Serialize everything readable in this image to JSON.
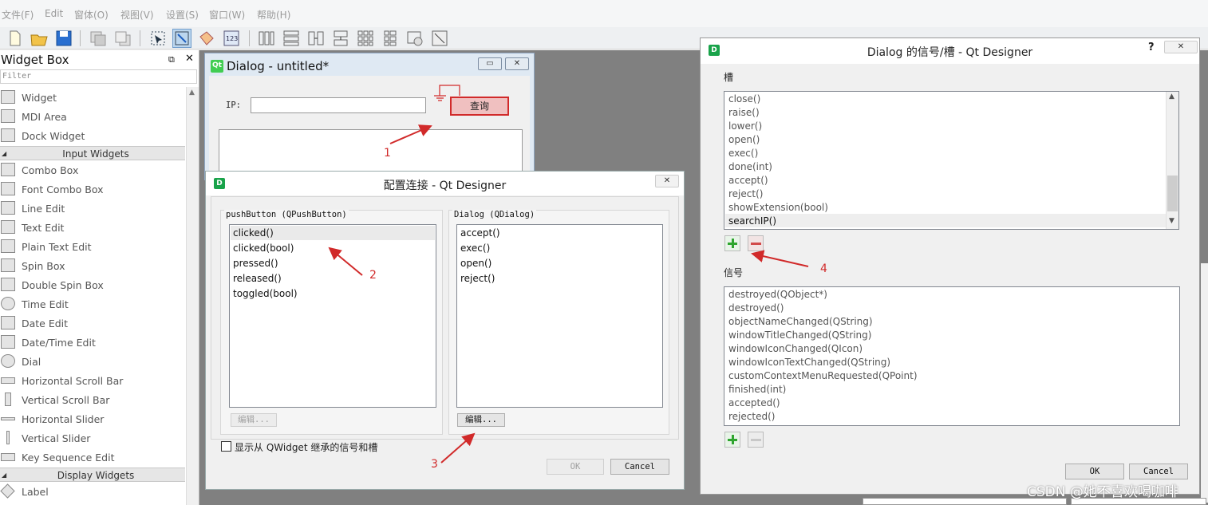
{
  "menubar": {
    "items": [
      "文件(F)",
      "Edit",
      "窗体(O)",
      "视图(V)",
      "设置(S)",
      "窗口(W)",
      "帮助(H)"
    ]
  },
  "widget_box": {
    "title": "Widget Box",
    "filter_placeholder": "Filter",
    "items": [
      "Widget",
      "MDI Area",
      "Dock Widget"
    ],
    "category_input": "Input Widgets",
    "input_items": [
      "Combo Box",
      "Font Combo Box",
      "Line Edit",
      "Text Edit",
      "Plain Text Edit",
      "Spin Box",
      "Double Spin Box",
      "Time Edit",
      "Date Edit",
      "Date/Time Edit",
      "Dial",
      "Horizontal Scroll Bar",
      "Vertical Scroll Bar",
      "Horizontal Slider",
      "Vertical Slider",
      "Key Sequence Edit"
    ],
    "category_display": "Display Widgets",
    "display_items": [
      "Label"
    ]
  },
  "form_dialog": {
    "title": "Dialog - untitled*",
    "ip_label": "IP:",
    "query_button": "查询"
  },
  "config_dialog": {
    "title": "配置连接 - Qt Designer",
    "left_group": "pushButton (QPushButton)",
    "left_items": [
      "clicked()",
      "clicked(bool)",
      "pressed()",
      "released()",
      "toggled(bool)"
    ],
    "left_edit": "编辑...",
    "right_group": "Dialog (QDialog)",
    "right_items": [
      "accept()",
      "exec()",
      "open()",
      "reject()"
    ],
    "right_edit": "编辑...",
    "checkbox_label": "显示从 QWidget 继承的信号和槽",
    "ok": "OK",
    "cancel": "Cancel"
  },
  "signal_slot_dialog": {
    "title": "Dialog 的信号/槽 - Qt Designer",
    "help": "?",
    "slots_label": "槽",
    "slots": [
      "close()",
      "raise()",
      "lower()",
      "open()",
      "exec()",
      "done(int)",
      "accept()",
      "reject()",
      "showExtension(bool)",
      "searchIP()"
    ],
    "signals_label": "信号",
    "signals": [
      "destroyed(QObject*)",
      "destroyed()",
      "objectNameChanged(QString)",
      "windowTitleChanged(QString)",
      "windowIconChanged(QIcon)",
      "windowIconTextChanged(QString)",
      "customContextMenuRequested(QPoint)",
      "finished(int)",
      "accepted()",
      "rejected()"
    ],
    "ok": "OK",
    "cancel": "Cancel"
  },
  "annotations": [
    "1",
    "2",
    "3",
    "4"
  ],
  "watermark": "CSDN @她不喜欢喝咖啡",
  "colors": {
    "accent_red": "#d12a2a",
    "qt_green": "#19a34a",
    "query_button_bg": "#f0c0c0"
  }
}
